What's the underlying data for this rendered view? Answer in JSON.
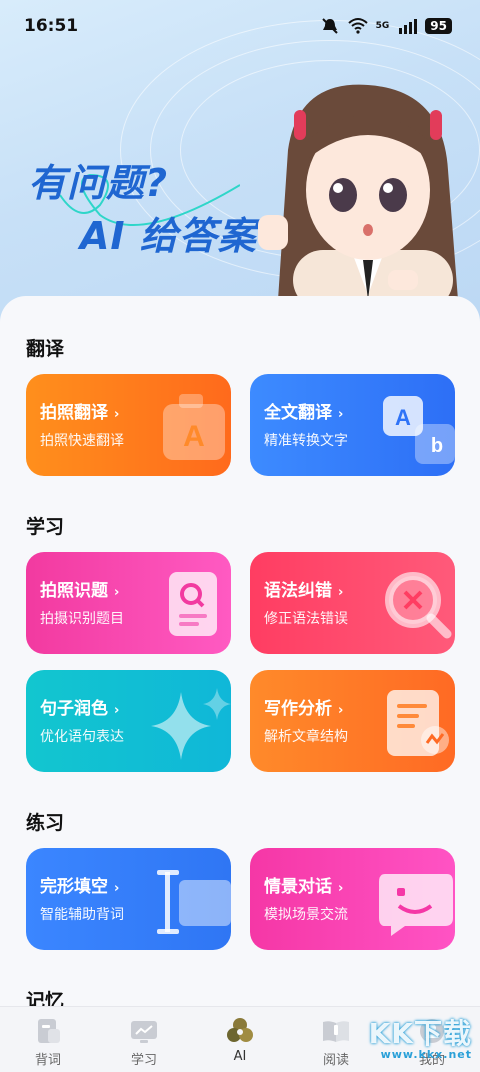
{
  "status_bar": {
    "time": "16:51",
    "network": "5G",
    "battery": "95"
  },
  "hero": {
    "line1": "有问题?",
    "line2": "AI 给答案"
  },
  "sections": {
    "translate": {
      "title": "翻译",
      "cards": [
        {
          "title": "拍照翻译",
          "sub": "拍照快速翻译",
          "color": "#ff7a1c",
          "icon": "camera-a-icon"
        },
        {
          "title": "全文翻译",
          "sub": "精准转换文字",
          "color": "#2f73f7",
          "icon": "translate-ab-icon"
        }
      ]
    },
    "study": {
      "title": "学习",
      "cards": [
        {
          "title": "拍照识题",
          "sub": "拍摄识别题目",
          "color": "#f23aa0",
          "icon": "scan-document-icon"
        },
        {
          "title": "语法纠错",
          "sub": "修正语法错误",
          "color": "#ff3d62",
          "icon": "magnifier-x-icon"
        },
        {
          "title": "句子润色",
          "sub": "优化语句表达",
          "color": "#12c6cf",
          "icon": "sparkle-icon"
        },
        {
          "title": "写作分析",
          "sub": "解析文章结构",
          "color": "#ff7a26",
          "icon": "document-chart-icon"
        }
      ]
    },
    "practice": {
      "title": "练习",
      "cards": [
        {
          "title": "完形填空",
          "sub": "智能辅助背词",
          "color": "#3b86ff",
          "icon": "text-cursor-icon"
        },
        {
          "title": "情景对话",
          "sub": "模拟场景交流",
          "color": "#f537a6",
          "icon": "chat-smile-icon"
        }
      ]
    },
    "memory": {
      "title": "记忆"
    }
  },
  "tabbar": [
    {
      "label": "背词",
      "icon": "cards-icon"
    },
    {
      "label": "学习",
      "icon": "monitor-icon"
    },
    {
      "label": "AI",
      "icon": "ai-icon",
      "active": true
    },
    {
      "label": "阅读",
      "icon": "book-icon"
    },
    {
      "label": "我的",
      "icon": "profile-icon"
    }
  ],
  "watermark": {
    "text": "KK下载",
    "url": "www.kkx.net"
  }
}
